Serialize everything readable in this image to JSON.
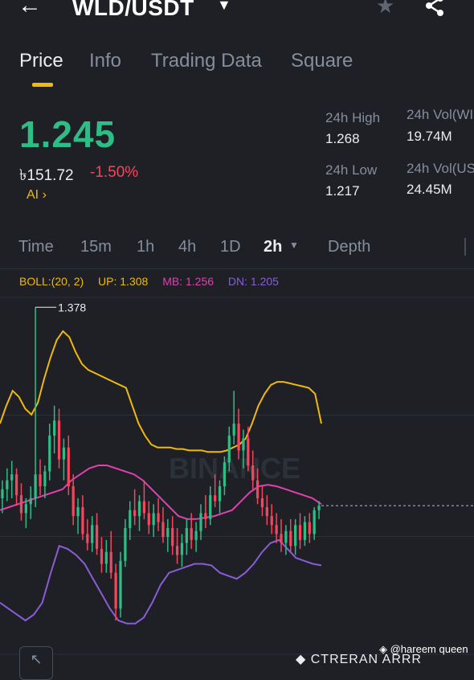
{
  "header": {
    "back_icon": "arrow-left-icon",
    "pair": "WLD/USDT",
    "caret_icon": "caret-down-icon",
    "star_icon": "star-icon",
    "share_icon": "share-icon"
  },
  "tabs": [
    "Price",
    "Info",
    "Trading Data",
    "Square"
  ],
  "price": {
    "last": "1.245",
    "fiat": "৳151.72",
    "change": "-1.50%",
    "ai_label": "AI  ›"
  },
  "stats": {
    "high_label": "24h High",
    "high_value": "1.268",
    "low_label": "24h Low",
    "low_value": "1.217",
    "vol1_label": "24h Vol(WI",
    "vol1_value": "19.74M",
    "vol2_label": "24h Vol(US",
    "vol2_value": "24.45M"
  },
  "timeframes": [
    "Time",
    "15m",
    "1h",
    "4h",
    "1D",
    "2h",
    "Depth"
  ],
  "indicator": {
    "boll": "BOLL:(20, 2)",
    "up": "UP: 1.308",
    "mb": "MB: 1.256",
    "dn": "DN: 1.205"
  },
  "chart_data": {
    "type": "candlestick",
    "max_label": "1.378",
    "watermark": "BINANCE",
    "colors": {
      "up": "#2ebd85",
      "down": "#f6465d",
      "upper": "#f0b90b",
      "mid": "#e040b0",
      "lower": "#8a5cd6"
    },
    "candles": [
      [
        1.25,
        1.262,
        1.24,
        1.256
      ],
      [
        1.256,
        1.27,
        1.248,
        1.262
      ],
      [
        1.262,
        1.275,
        1.25,
        1.266
      ],
      [
        1.266,
        1.27,
        1.245,
        1.252
      ],
      [
        1.252,
        1.26,
        1.235,
        1.24
      ],
      [
        1.24,
        1.25,
        1.23,
        1.246
      ],
      [
        1.246,
        1.258,
        1.236,
        1.25
      ],
      [
        1.25,
        1.378,
        1.244,
        1.266
      ],
      [
        1.266,
        1.276,
        1.252,
        1.258
      ],
      [
        1.258,
        1.272,
        1.25,
        1.268
      ],
      [
        1.268,
        1.3,
        1.262,
        1.292
      ],
      [
        1.292,
        1.312,
        1.28,
        1.302
      ],
      [
        1.302,
        1.31,
        1.27,
        1.276
      ],
      [
        1.276,
        1.29,
        1.262,
        1.284
      ],
      [
        1.284,
        1.292,
        1.252,
        1.258
      ],
      [
        1.258,
        1.266,
        1.232,
        1.238
      ],
      [
        1.238,
        1.25,
        1.226,
        1.244
      ],
      [
        1.244,
        1.252,
        1.222,
        1.226
      ],
      [
        1.226,
        1.236,
        1.215,
        1.22
      ],
      [
        1.22,
        1.238,
        1.214,
        1.232
      ],
      [
        1.232,
        1.24,
        1.212,
        1.216
      ],
      [
        1.216,
        1.224,
        1.2,
        1.206
      ],
      [
        1.206,
        1.222,
        1.2,
        1.214
      ],
      [
        1.214,
        1.228,
        1.196,
        1.2
      ],
      [
        1.2,
        1.206,
        1.168,
        1.176
      ],
      [
        1.176,
        1.214,
        1.17,
        1.208
      ],
      [
        1.208,
        1.236,
        1.204,
        1.23
      ],
      [
        1.23,
        1.248,
        1.222,
        1.242
      ],
      [
        1.242,
        1.256,
        1.232,
        1.238
      ],
      [
        1.238,
        1.252,
        1.228,
        1.248
      ],
      [
        1.248,
        1.262,
        1.236,
        1.24
      ],
      [
        1.24,
        1.248,
        1.226,
        1.232
      ],
      [
        1.232,
        1.246,
        1.224,
        1.24
      ],
      [
        1.24,
        1.25,
        1.228,
        1.234
      ],
      [
        1.234,
        1.244,
        1.22,
        1.224
      ],
      [
        1.224,
        1.236,
        1.214,
        1.23
      ],
      [
        1.23,
        1.238,
        1.212,
        1.218
      ],
      [
        1.218,
        1.23,
        1.206,
        1.212
      ],
      [
        1.212,
        1.226,
        1.204,
        1.22
      ],
      [
        1.22,
        1.236,
        1.212,
        1.23
      ],
      [
        1.23,
        1.24,
        1.216,
        1.222
      ],
      [
        1.222,
        1.234,
        1.214,
        1.228
      ],
      [
        1.228,
        1.246,
        1.222,
        1.24
      ],
      [
        1.24,
        1.252,
        1.23,
        1.236
      ],
      [
        1.236,
        1.258,
        1.232,
        1.252
      ],
      [
        1.252,
        1.266,
        1.244,
        1.248
      ],
      [
        1.248,
        1.262,
        1.24,
        1.258
      ],
      [
        1.258,
        1.278,
        1.252,
        1.274
      ],
      [
        1.274,
        1.298,
        1.268,
        1.292
      ],
      [
        1.292,
        1.322,
        1.286,
        1.3
      ],
      [
        1.3,
        1.31,
        1.276,
        1.282
      ],
      [
        1.282,
        1.296,
        1.27,
        1.29
      ],
      [
        1.29,
        1.298,
        1.268,
        1.272
      ],
      [
        1.272,
        1.282,
        1.256,
        1.262
      ],
      [
        1.262,
        1.27,
        1.246,
        1.25
      ],
      [
        1.25,
        1.258,
        1.238,
        1.244
      ],
      [
        1.244,
        1.252,
        1.232,
        1.238
      ],
      [
        1.238,
        1.246,
        1.226,
        1.232
      ],
      [
        1.232,
        1.24,
        1.22,
        1.226
      ],
      [
        1.226,
        1.236,
        1.214,
        1.22
      ],
      [
        1.22,
        1.232,
        1.212,
        1.228
      ],
      [
        1.228,
        1.236,
        1.214,
        1.218
      ],
      [
        1.218,
        1.236,
        1.212,
        1.232
      ],
      [
        1.232,
        1.24,
        1.216,
        1.222
      ],
      [
        1.222,
        1.238,
        1.218,
        1.234
      ],
      [
        1.234,
        1.24,
        1.22,
        1.226
      ],
      [
        1.226,
        1.244,
        1.222,
        1.242
      ],
      [
        1.242,
        1.248,
        1.236,
        1.245
      ]
    ],
    "upper_band": [
      1.3,
      1.312,
      1.322,
      1.318,
      1.31,
      1.306,
      1.314,
      1.33,
      1.344,
      1.356,
      1.362,
      1.358,
      1.348,
      1.34,
      1.336,
      1.334,
      1.332,
      1.33,
      1.328,
      1.326,
      1.324,
      1.312,
      1.3,
      1.292,
      1.286,
      1.284,
      1.284,
      1.284,
      1.283,
      1.283,
      1.282,
      1.282,
      1.282,
      1.281,
      1.281,
      1.281,
      1.282,
      1.284,
      1.286,
      1.29,
      1.3,
      1.312,
      1.32,
      1.326,
      1.328,
      1.328,
      1.327,
      1.326,
      1.325,
      1.324,
      1.32,
      1.3
    ],
    "mid_band": [
      1.242,
      1.244,
      1.246,
      1.248,
      1.25,
      1.252,
      1.254,
      1.256,
      1.262,
      1.266,
      1.27,
      1.272,
      1.272,
      1.27,
      1.268,
      1.266,
      1.262,
      1.256,
      1.25,
      1.244,
      1.238,
      1.236,
      1.236,
      1.237,
      1.238,
      1.24,
      1.242,
      1.248,
      1.254,
      1.258,
      1.259,
      1.258,
      1.256,
      1.254,
      1.252,
      1.25,
      1.246
    ],
    "lower_band": [
      1.18,
      1.176,
      1.172,
      1.168,
      1.172,
      1.18,
      1.2,
      1.218,
      1.216,
      1.212,
      1.206,
      1.196,
      1.186,
      1.176,
      1.168,
      1.166,
      1.166,
      1.17,
      1.18,
      1.192,
      1.2,
      1.202,
      1.204,
      1.206,
      1.206,
      1.205,
      1.2,
      1.198,
      1.196,
      1.2,
      1.206,
      1.214,
      1.22,
      1.222,
      1.216,
      1.21,
      1.208,
      1.206,
      1.205
    ],
    "current": 1.245,
    "y_range": [
      1.14,
      1.39
    ]
  },
  "footer": {
    "credit": "◈ @hareem queen",
    "corner_icon": "expand-arrow-icon",
    "bottom": "◆ CTRERAN ARRR"
  }
}
